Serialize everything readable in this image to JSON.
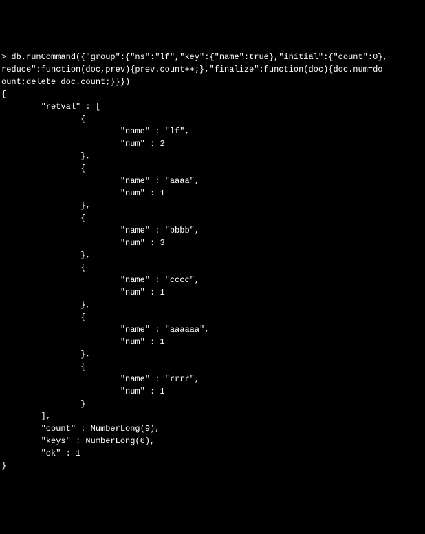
{
  "command_line1": "> db.runCommand({\"group\":{\"ns\":\"lf\",\"key\":{\"name\":true},\"initial\":{\"count\":0},",
  "command_line2": "reduce\":function(doc,prev){prev.count++;},\"finalize\":function(doc){doc.num=do",
  "command_line3": "ount;delete doc.count;}}})",
  "open_brace": "{",
  "retval_label": "        \"retval\" : [",
  "items": [
    {
      "name": "lf",
      "num": 2
    },
    {
      "name": "aaaa",
      "num": 1
    },
    {
      "name": "bbbb",
      "num": 3
    },
    {
      "name": "cccc",
      "num": 1
    },
    {
      "name": "aaaaaa",
      "num": 1
    },
    {
      "name": "rrrr",
      "num": 1
    }
  ],
  "close_array": "        ],",
  "count_line": "        \"count\" : NumberLong(9),",
  "keys_line": "        \"keys\" : NumberLong(6),",
  "ok_line": "        \"ok\" : 1",
  "close_brace": "}",
  "obj_open": "                {",
  "obj_close_comma": "                },",
  "obj_close": "                }",
  "name_prefix": "                        \"name\" : \"",
  "name_suffix": "\",",
  "num_prefix": "                        \"num\" : "
}
